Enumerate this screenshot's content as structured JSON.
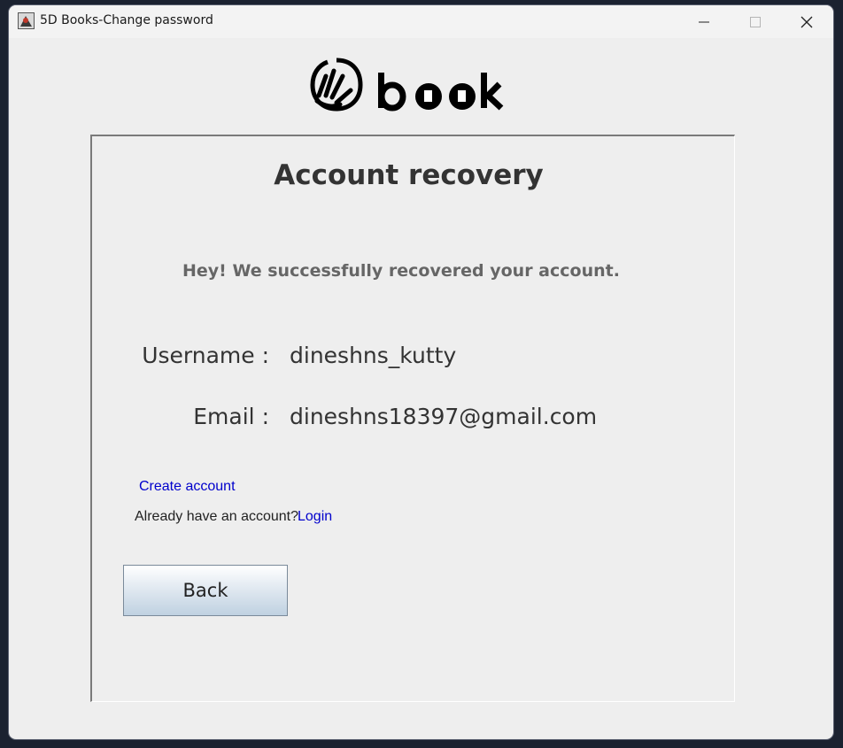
{
  "window": {
    "title": "5D Books-Change password",
    "icon": "app-icon"
  },
  "titlebar_buttons": {
    "minimize_icon": "minimize-icon",
    "maximize_icon": "maximize-icon",
    "close_icon": "close-icon"
  },
  "logo": {
    "text": "book"
  },
  "recovery": {
    "heading": "Account recovery",
    "message": "Hey! We successfully recovered your account.",
    "username_label": "Username :",
    "username_value": "dineshns_kutty",
    "email_label": "Email :",
    "email_value": "dineshns18397@gmail.com"
  },
  "links": {
    "create_account": "Create account",
    "already_text": "Already have an account?",
    "login": "Login"
  },
  "buttons": {
    "back": "Back"
  },
  "colors": {
    "link": "#0000cc",
    "heading": "#333333",
    "message": "#666666",
    "background": "#eeeeee"
  }
}
